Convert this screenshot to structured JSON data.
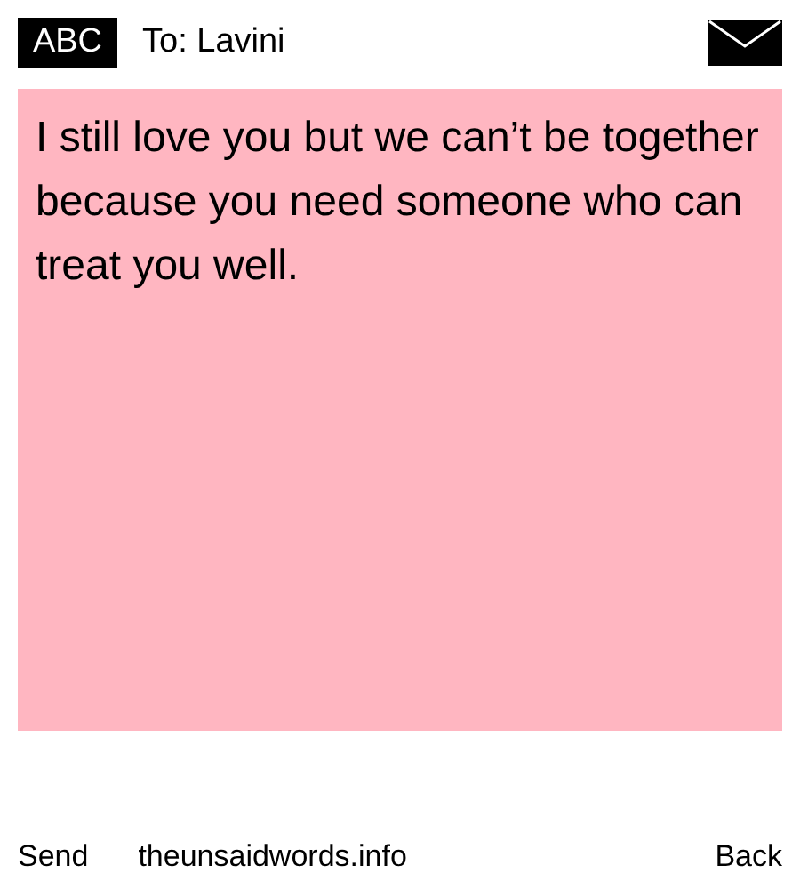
{
  "header": {
    "logo": "ABC",
    "recipient": "To: Lavini"
  },
  "message": {
    "text": "I still love you but we can’t be together because you need someone who can treat you well."
  },
  "footer": {
    "send": "Send",
    "site": "theunsaidwords.info",
    "back": "Back"
  }
}
